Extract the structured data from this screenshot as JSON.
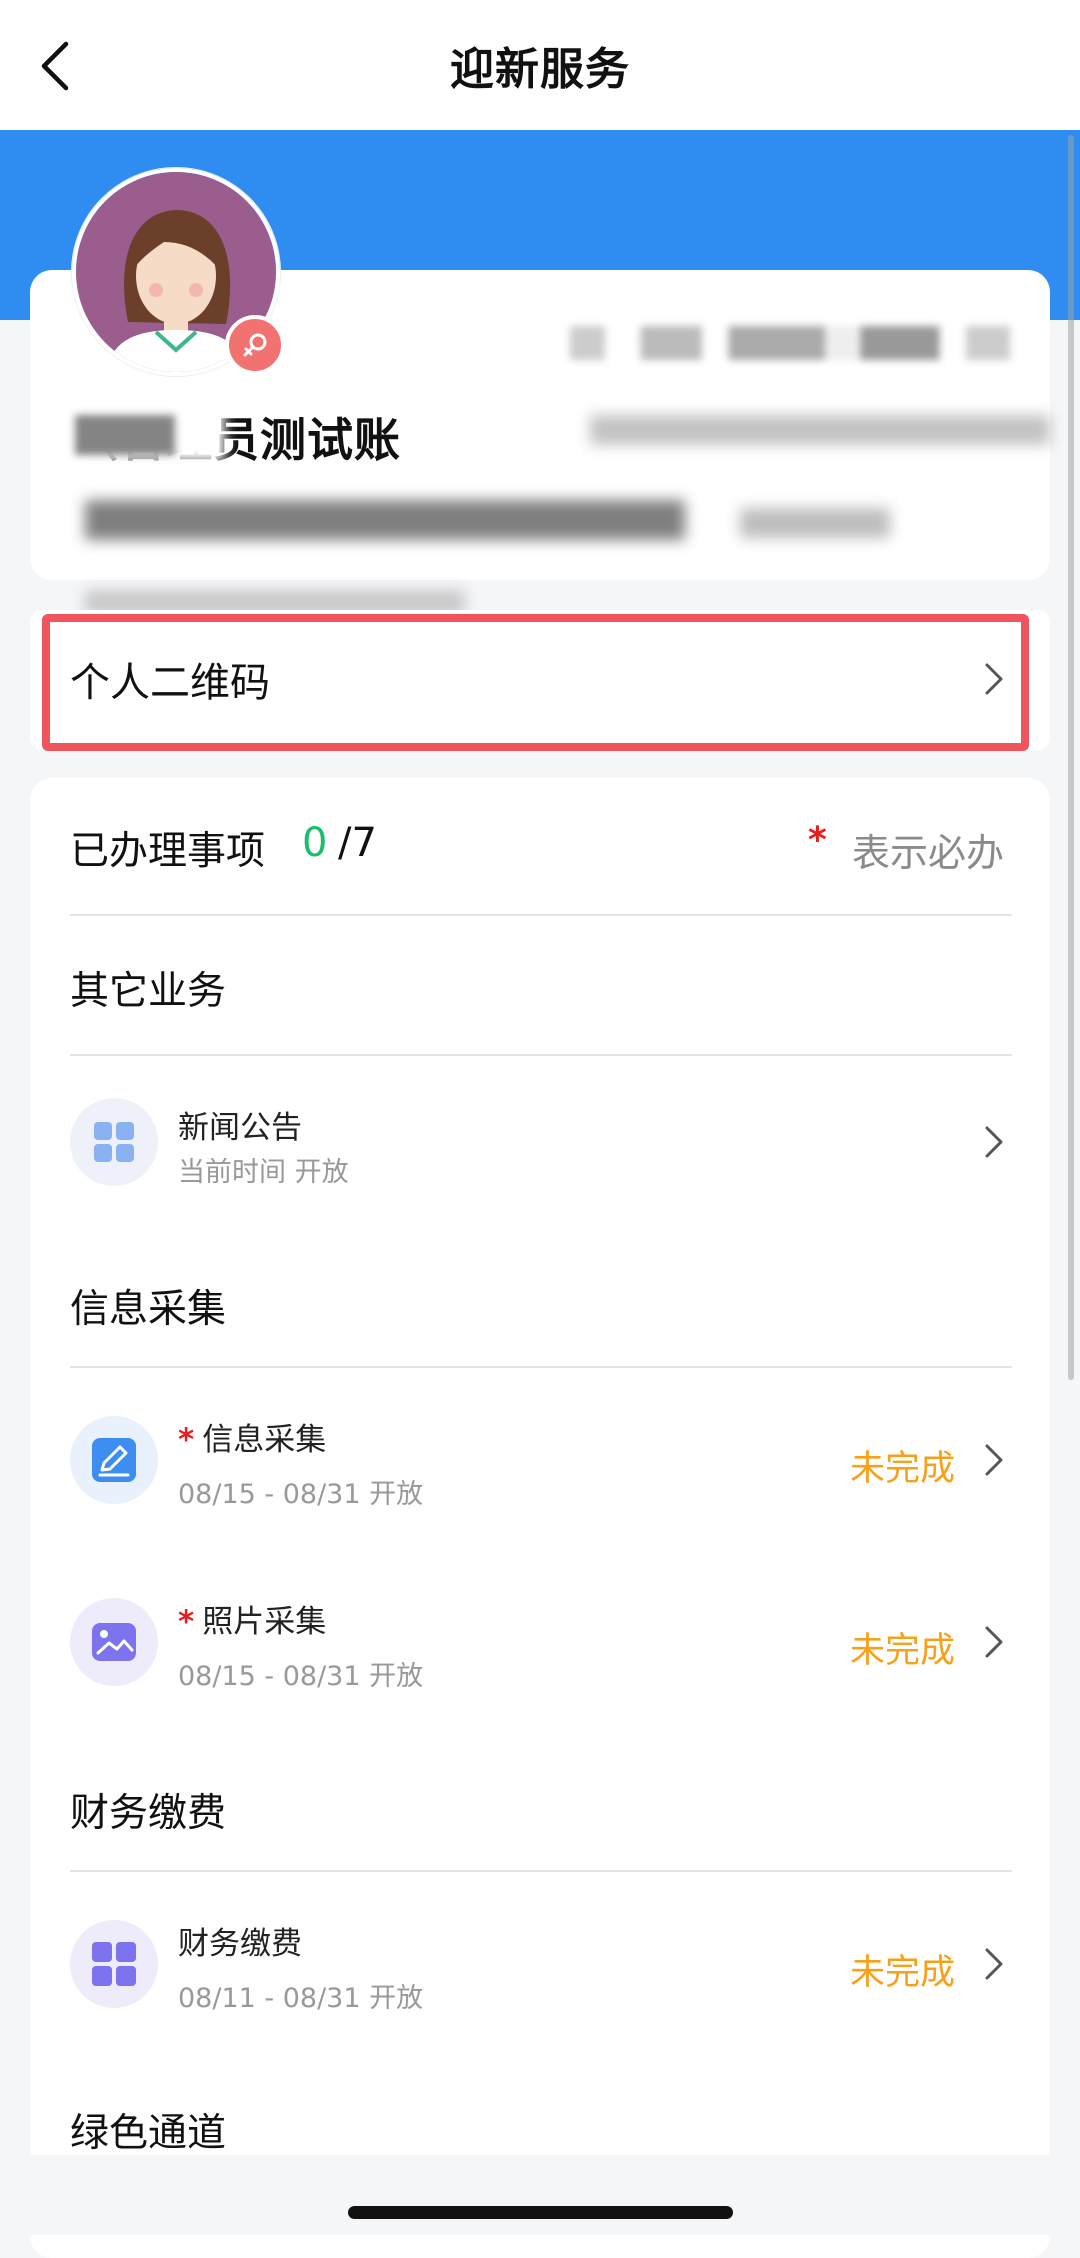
{
  "nav": {
    "title": "迎新服务",
    "back_icon": "chevron-left-icon"
  },
  "profile": {
    "name_visible": "（管理员测试账",
    "avatar": "female-avatar-icon",
    "gender_badge": "female-symbol-icon",
    "accent": "#2f8cf0"
  },
  "qr": {
    "label": "个人二维码",
    "highlight_color": "#f0545c"
  },
  "progress": {
    "label": "已办理事项",
    "done": "0",
    "total": "/7",
    "legend_star": "*",
    "legend_text": "表示必办"
  },
  "sections": [
    {
      "title": "其它业务",
      "items": [
        {
          "title": "新闻公告",
          "subtitle": "当前时间 开放",
          "required": false,
          "status": "",
          "icon": "grid-icon"
        }
      ]
    },
    {
      "title": "信息采集",
      "items": [
        {
          "title": "信息采集",
          "subtitle": "08/15 - 08/31 开放",
          "required": true,
          "status": "未完成",
          "icon": "edit-form-icon"
        },
        {
          "title": "照片采集",
          "subtitle": "08/15 - 08/31 开放",
          "required": true,
          "status": "未完成",
          "icon": "image-icon"
        }
      ]
    },
    {
      "title": "财务缴费",
      "items": [
        {
          "title": "财务缴费",
          "subtitle": "08/11 - 08/31 开放",
          "required": false,
          "status": "未完成",
          "icon": "grid-icon"
        }
      ]
    },
    {
      "title": "绿色通道",
      "items": []
    }
  ],
  "colors": {
    "status": "#f7a11a",
    "done_count": "#19be6b",
    "required_star": "#e81d1d"
  }
}
